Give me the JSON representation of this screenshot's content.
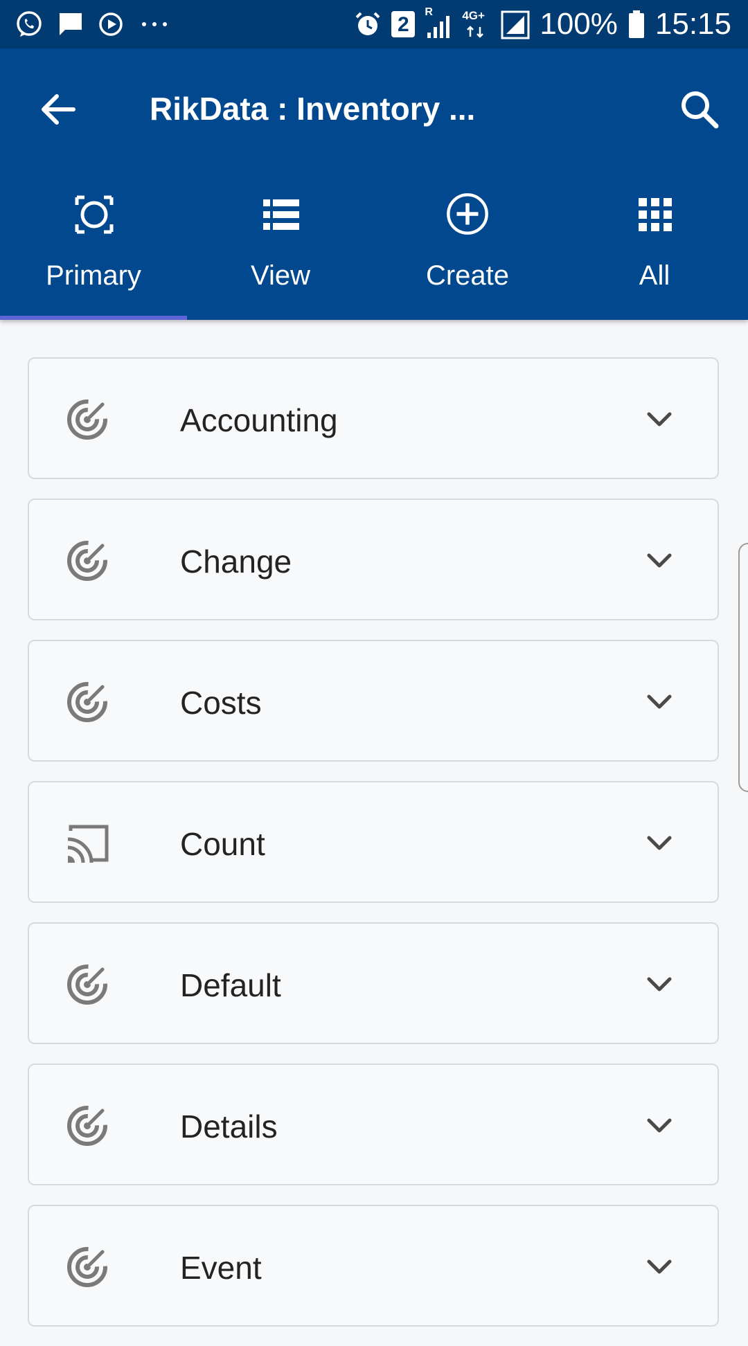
{
  "status_bar": {
    "notif_count": "2",
    "network": "4G+",
    "roaming": "R",
    "battery": "100%",
    "time": "15:15",
    "left_icons": [
      "whatsapp-icon",
      "message-icon",
      "media-icon",
      "more-dots-icon"
    ]
  },
  "app_bar": {
    "title": "RikData : Inventory ...",
    "back_icon": "arrow-left-icon",
    "search_icon": "search-icon"
  },
  "tabs": [
    {
      "label": "Primary",
      "icon": "focus-icon",
      "active": true
    },
    {
      "label": "View",
      "icon": "list-icon",
      "active": false
    },
    {
      "label": "Create",
      "icon": "add-circle-icon",
      "active": false
    },
    {
      "label": "All",
      "icon": "apps-grid-icon",
      "active": false
    }
  ],
  "items": [
    {
      "label": "Accounting",
      "icon": "radar-icon"
    },
    {
      "label": "Change",
      "icon": "radar-icon"
    },
    {
      "label": "Costs",
      "icon": "radar-icon"
    },
    {
      "label": "Count",
      "icon": "cast-icon"
    },
    {
      "label": "Default",
      "icon": "radar-icon"
    },
    {
      "label": "Details",
      "icon": "radar-icon"
    },
    {
      "label": "Event",
      "icon": "radar-icon"
    }
  ],
  "colors": {
    "status_bar_bg": "#023b72",
    "app_bar_bg": "#02488f",
    "tab_indicator": "#5e63d6",
    "page_bg": "#f6f7f9",
    "item_border": "#d8d9dc",
    "icon_gray": "#7a7a7a"
  }
}
